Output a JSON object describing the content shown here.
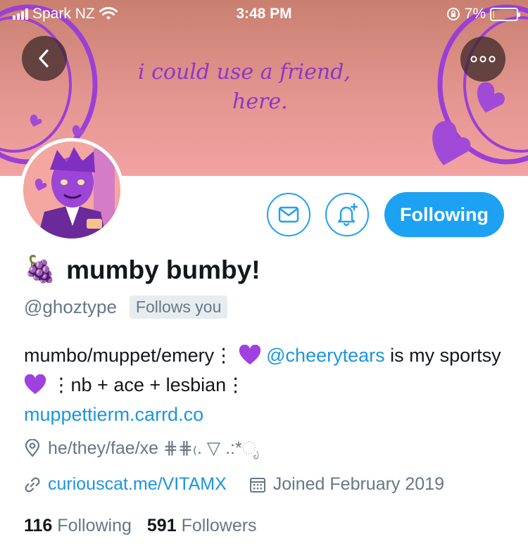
{
  "status_bar": {
    "carrier": "Spark NZ",
    "time": "3:48 PM",
    "battery_percent": "7%",
    "battery_level": 0.07,
    "battery_color": "#ffd60a"
  },
  "banner": {
    "text_line1": "i could use a friend,",
    "text_line2": "here."
  },
  "profile": {
    "display_name": "mumby bumby!",
    "name_emoji": "🍇",
    "handle": "@ghoztype",
    "follows_you_label": "Follows you",
    "following_button_label": "Following",
    "bio": {
      "part1": "mumbo/muppet/emery⋮",
      "mention": "@cheerytears",
      "part2": " is my sportsy ",
      "part3": "⋮nb + ace + lesbian⋮",
      "link": "muppettierm.carrd.co"
    },
    "location": "he/they/fae/xe ⋕⋕₍. ▽ .:*ೃ",
    "website": "curiouscat.me/VITAMX",
    "joined": "Joined February 2019",
    "following_count": "116",
    "following_label": "Following",
    "followers_count": "591",
    "followers_label": "Followers"
  },
  "colors": {
    "accent": "#1da1f2",
    "link": "#1b95e0",
    "secondary_text": "#657786",
    "banner_purple": "#8e35c9"
  },
  "icons": [
    "signal-icon",
    "wifi-icon",
    "rotation-lock-icon",
    "battery-icon",
    "back-arrow-icon",
    "more-icon",
    "envelope-icon",
    "bell-plus-icon",
    "purple-heart-icon",
    "location-icon",
    "link-icon",
    "calendar-icon"
  ]
}
